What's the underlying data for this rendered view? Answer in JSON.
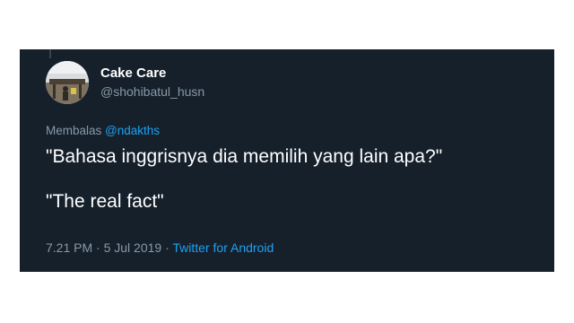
{
  "tweet": {
    "author_name": "Cake Care",
    "author_handle": "@shohibatul_husn",
    "reply_prefix": "Membalas",
    "reply_to": "@ndakths",
    "text_lines": [
      "\"Bahasa inggrisnya dia memilih yang lain apa?\"",
      "\"The real fact\""
    ],
    "time": "7.21 PM",
    "separator": "·",
    "date": "5 Jul 2019",
    "source": "Twitter for Android"
  },
  "colors": {
    "background": "#15202b",
    "text_primary": "#ffffff",
    "text_secondary": "#8899a6",
    "link": "#1da1f2"
  },
  "icons": {
    "avatar": "user-avatar-photo"
  }
}
